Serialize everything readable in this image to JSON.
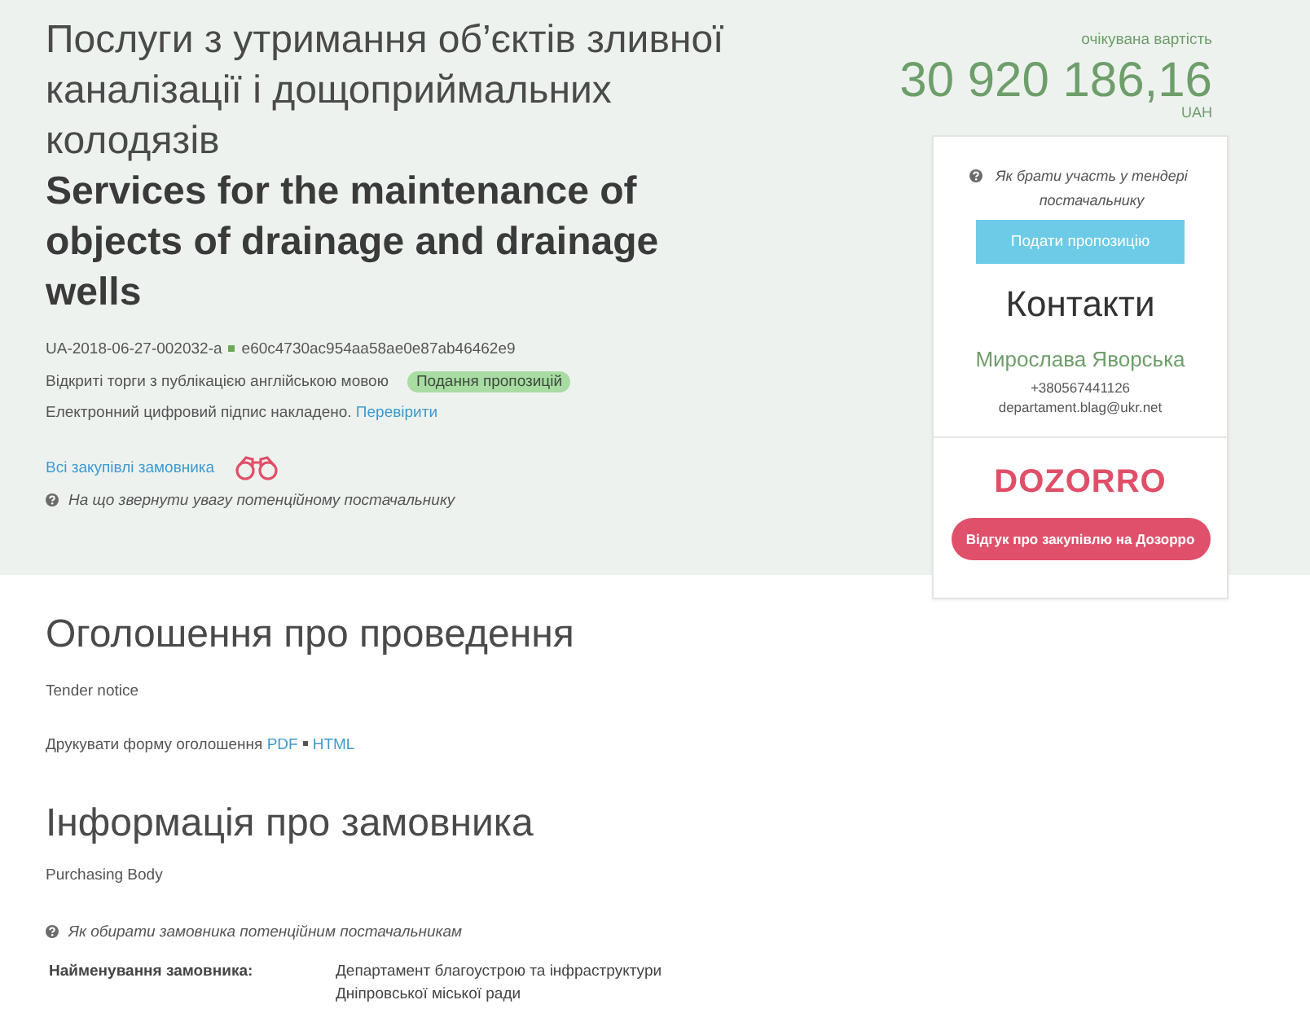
{
  "tender": {
    "title": "Послуги з утримання об’єктів зливної каналізації і дощоприймальних колодязів",
    "title_english": "Services for the maintenance of objects of drainage and drainage wells",
    "id": "UA-2018-06-27-002032-a",
    "hash": "e60c4730ac954aa58ae0e87ab46462e9",
    "procedure": "Відкриті торги з публікацією англійською мовою",
    "status": "Подання пропозицій",
    "signature": {
      "text": "Електронний цифровий підпис накладено.",
      "link": "Перевірити"
    },
    "all_purchases_link": "Всі закупівлі замовника",
    "help_note": "На що звернути увагу потенційному постачальнику"
  },
  "price": {
    "label": "очікувана вартість",
    "amount": "30 920 186,16",
    "currency": "UAH"
  },
  "side_card": {
    "help_note": "Як брати участь у тендері постачальнику",
    "submit_button": "Подати пропозицію",
    "contacts_title": "Контакти",
    "contact_name": "Мирослава Яворська",
    "phone": "+380567441126",
    "email": "departament.blag@ukr.net",
    "logo": "DOZORRO",
    "review_button": "Відгук про закупівлю на Дозорро"
  },
  "sections": [
    {
      "title": "Оголошення про проведення",
      "subtitle": "Tender notice",
      "print": {
        "text": "Друкувати форму оголошення",
        "links": [
          "PDF",
          "HTML"
        ]
      }
    },
    {
      "title": "Інформація про замовника",
      "subtitle": "Purchasing Body",
      "help_note": "Як обирати замовника потенційним постачальникам",
      "fields": [
        {
          "label": "Найменування замовника:",
          "value": "Департамент благоустрою та інфраструктури Дніпровської міської ради"
        }
      ]
    }
  ]
}
